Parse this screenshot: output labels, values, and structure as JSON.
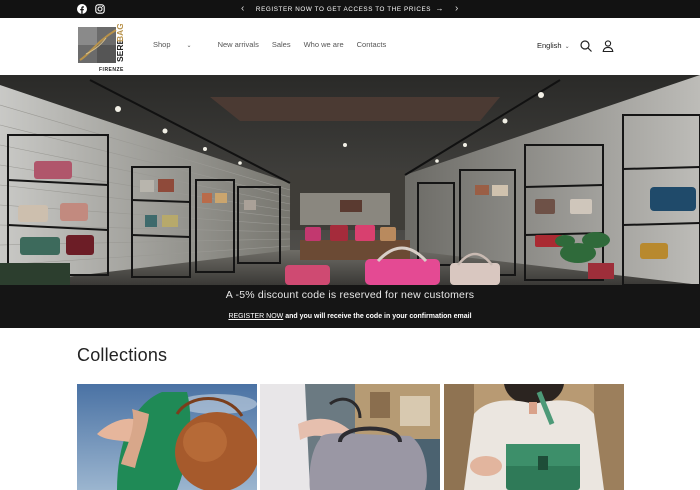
{
  "announcement": {
    "text": "REGISTER NOW TO GET ACCESS TO THE PRICES",
    "arrow": "→",
    "prev": "‹",
    "next": "›",
    "social_icons": [
      "facebook-icon",
      "instagram-icon"
    ]
  },
  "logo": {
    "brand": "SERE BAGS",
    "city": "FIRENZE"
  },
  "nav": {
    "items": [
      "Shop",
      "New arrivals",
      "Sales",
      "Who we are",
      "Contacts"
    ],
    "dropdown_glyph": "⌄"
  },
  "header": {
    "language": "English",
    "icons": [
      "search-icon",
      "account-icon"
    ]
  },
  "promo": {
    "title": "A -5% discount code is reserved for new customers",
    "link_text": "REGISTER NOW",
    "rest_text": " and you will receive the code in your confirmation email"
  },
  "collections": {
    "title": "Collections",
    "cards": [
      "collection-card-green-brown",
      "collection-card-grey",
      "collection-card-green"
    ]
  },
  "colors": {
    "bar_bg": "#121212",
    "promo_bg": "#151515",
    "accent_gold": "#b8924a"
  }
}
